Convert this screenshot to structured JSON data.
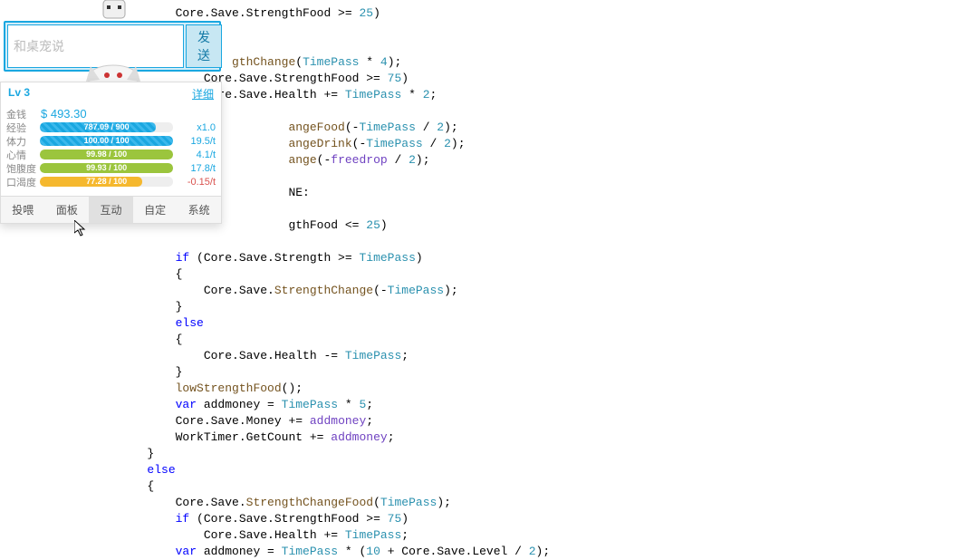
{
  "chat": {
    "placeholder": "和桌宠说",
    "send_label": "发送"
  },
  "stats": {
    "level": "Lv 3",
    "detail_label": "详细",
    "money": {
      "label": "金钱",
      "value": "$ 493.30"
    },
    "rows": [
      {
        "label": "经验",
        "text": "787.09 / 900",
        "pct": 87,
        "color": "bar-blue",
        "rate": "x1.0",
        "rate_color": "#1aa7e0"
      },
      {
        "label": "体力",
        "text": "100.00 / 100",
        "pct": 100,
        "color": "bar-blue",
        "rate": "19.5/t",
        "rate_color": "#1aa7e0"
      },
      {
        "label": "心情",
        "text": "99.98 / 100",
        "pct": 100,
        "color": "bar-green",
        "rate": "4.1/t",
        "rate_color": "#1aa7e0"
      },
      {
        "label": "饱腹度",
        "text": "99.93 / 100",
        "pct": 100,
        "color": "bar-green",
        "rate": "17.8/t",
        "rate_color": "#1aa7e0"
      },
      {
        "label": "口渴度",
        "text": "77.28 / 100",
        "pct": 77,
        "color": "bar-yellow",
        "rate": "-0.15/t",
        "rate_color": "#d9534f"
      }
    ]
  },
  "tabs": [
    "投喂",
    "面板",
    "互动",
    "自定",
    "系统"
  ],
  "active_tab": 2,
  "code_lines": [
    {
      "indent": 3,
      "tokens": [
        {
          "t": "Core.Save.StrengthFood >= ",
          "c": ""
        },
        {
          "t": "25",
          "c": "member"
        },
        {
          "t": ")",
          "c": ""
        }
      ]
    },
    {
      "indent": 0,
      "tokens": []
    },
    {
      "indent": 0,
      "tokens": []
    },
    {
      "indent": 5,
      "tokens": [
        {
          "t": "gthChange",
          "c": "method"
        },
        {
          "t": "(",
          "c": ""
        },
        {
          "t": "TimePass",
          "c": "member"
        },
        {
          "t": " * ",
          "c": ""
        },
        {
          "t": "4",
          "c": "member"
        },
        {
          "t": ");",
          "c": ""
        }
      ]
    },
    {
      "indent": 4,
      "tokens": [
        {
          "t": "Core.Save.StrengthFood >= ",
          "c": ""
        },
        {
          "t": "75",
          "c": "member"
        },
        {
          "t": ")",
          "c": ""
        }
      ]
    },
    {
      "indent": 4,
      "tokens": [
        {
          "t": "Core.Save.Health += ",
          "c": ""
        },
        {
          "t": "TimePass",
          "c": "member"
        },
        {
          "t": " * ",
          "c": ""
        },
        {
          "t": "2",
          "c": "member"
        },
        {
          "t": ";",
          "c": ""
        }
      ]
    },
    {
      "indent": 0,
      "tokens": []
    },
    {
      "indent": 7,
      "tokens": [
        {
          "t": "angeFood",
          "c": "method"
        },
        {
          "t": "(-",
          "c": ""
        },
        {
          "t": "TimePass",
          "c": "member"
        },
        {
          "t": " / ",
          "c": ""
        },
        {
          "t": "2",
          "c": "member"
        },
        {
          "t": ");",
          "c": ""
        }
      ]
    },
    {
      "indent": 7,
      "tokens": [
        {
          "t": "angeDrink",
          "c": "method"
        },
        {
          "t": "(-",
          "c": ""
        },
        {
          "t": "TimePass",
          "c": "member"
        },
        {
          "t": " / ",
          "c": ""
        },
        {
          "t": "2",
          "c": "member"
        },
        {
          "t": ");",
          "c": ""
        }
      ]
    },
    {
      "indent": 7,
      "tokens": [
        {
          "t": "ange",
          "c": "method"
        },
        {
          "t": "(-",
          "c": ""
        },
        {
          "t": "freedrop",
          "c": "purple"
        },
        {
          "t": " / ",
          "c": ""
        },
        {
          "t": "2",
          "c": "member"
        },
        {
          "t": ");",
          "c": ""
        }
      ]
    },
    {
      "indent": 0,
      "tokens": []
    },
    {
      "indent": 7,
      "tokens": [
        {
          "t": "NE:",
          "c": ""
        }
      ]
    },
    {
      "indent": 0,
      "tokens": []
    },
    {
      "indent": 7,
      "tokens": [
        {
          "t": "gthFood <= ",
          "c": ""
        },
        {
          "t": "25",
          "c": "member"
        },
        {
          "t": ")",
          "c": ""
        }
      ]
    },
    {
      "indent": 0,
      "tokens": []
    },
    {
      "indent": 3,
      "tokens": [
        {
          "t": "if",
          "c": "kw"
        },
        {
          "t": " (Core.Save.Strength >= ",
          "c": ""
        },
        {
          "t": "TimePass",
          "c": "member"
        },
        {
          "t": ")",
          "c": ""
        }
      ]
    },
    {
      "indent": 3,
      "tokens": [
        {
          "t": "{",
          "c": ""
        }
      ]
    },
    {
      "indent": 4,
      "tokens": [
        {
          "t": "Core.Save.",
          "c": ""
        },
        {
          "t": "StrengthChange",
          "c": "method"
        },
        {
          "t": "(-",
          "c": ""
        },
        {
          "t": "TimePass",
          "c": "member"
        },
        {
          "t": ");",
          "c": ""
        }
      ]
    },
    {
      "indent": 3,
      "tokens": [
        {
          "t": "}",
          "c": ""
        }
      ]
    },
    {
      "indent": 3,
      "tokens": [
        {
          "t": "else",
          "c": "kw"
        }
      ]
    },
    {
      "indent": 3,
      "tokens": [
        {
          "t": "{",
          "c": ""
        }
      ]
    },
    {
      "indent": 4,
      "tokens": [
        {
          "t": "Core.Save.Health -= ",
          "c": ""
        },
        {
          "t": "TimePass",
          "c": "member"
        },
        {
          "t": ";",
          "c": ""
        }
      ]
    },
    {
      "indent": 3,
      "tokens": [
        {
          "t": "}",
          "c": ""
        }
      ]
    },
    {
      "indent": 3,
      "tokens": [
        {
          "t": "lowStrengthFood",
          "c": "method"
        },
        {
          "t": "();",
          "c": ""
        }
      ]
    },
    {
      "indent": 3,
      "tokens": [
        {
          "t": "var",
          "c": "kw"
        },
        {
          "t": " addmoney = ",
          "c": ""
        },
        {
          "t": "TimePass",
          "c": "member"
        },
        {
          "t": " * ",
          "c": ""
        },
        {
          "t": "5",
          "c": "member"
        },
        {
          "t": ";",
          "c": ""
        }
      ]
    },
    {
      "indent": 3,
      "tokens": [
        {
          "t": "Core.Save.Money += ",
          "c": ""
        },
        {
          "t": "addmoney",
          "c": "purple"
        },
        {
          "t": ";",
          "c": ""
        }
      ]
    },
    {
      "indent": 3,
      "tokens": [
        {
          "t": "WorkTimer.GetCount += ",
          "c": ""
        },
        {
          "t": "addmoney",
          "c": "purple"
        },
        {
          "t": ";",
          "c": ""
        }
      ]
    },
    {
      "indent": 2,
      "tokens": [
        {
          "t": "}",
          "c": ""
        }
      ]
    },
    {
      "indent": 2,
      "tokens": [
        {
          "t": "else",
          "c": "kw"
        }
      ]
    },
    {
      "indent": 2,
      "tokens": [
        {
          "t": "{",
          "c": ""
        }
      ]
    },
    {
      "indent": 3,
      "tokens": [
        {
          "t": "Core.Save.",
          "c": ""
        },
        {
          "t": "StrengthChangeFood",
          "c": "method"
        },
        {
          "t": "(",
          "c": ""
        },
        {
          "t": "TimePass",
          "c": "member"
        },
        {
          "t": ");",
          "c": ""
        }
      ]
    },
    {
      "indent": 3,
      "tokens": [
        {
          "t": "if",
          "c": "kw"
        },
        {
          "t": " (Core.Save.StrengthFood >= ",
          "c": ""
        },
        {
          "t": "75",
          "c": "member"
        },
        {
          "t": ")",
          "c": ""
        }
      ]
    },
    {
      "indent": 4,
      "tokens": [
        {
          "t": "Core.Save.Health += ",
          "c": ""
        },
        {
          "t": "TimePass",
          "c": "member"
        },
        {
          "t": ";",
          "c": ""
        }
      ]
    },
    {
      "indent": 3,
      "tokens": [
        {
          "t": "var",
          "c": "kw"
        },
        {
          "t": " addmoney = ",
          "c": ""
        },
        {
          "t": "TimePass",
          "c": "member"
        },
        {
          "t": " * (",
          "c": ""
        },
        {
          "t": "10",
          "c": "member"
        },
        {
          "t": " + Core.Save.Level / ",
          "c": ""
        },
        {
          "t": "2",
          "c": "member"
        },
        {
          "t": ");",
          "c": ""
        }
      ]
    }
  ]
}
